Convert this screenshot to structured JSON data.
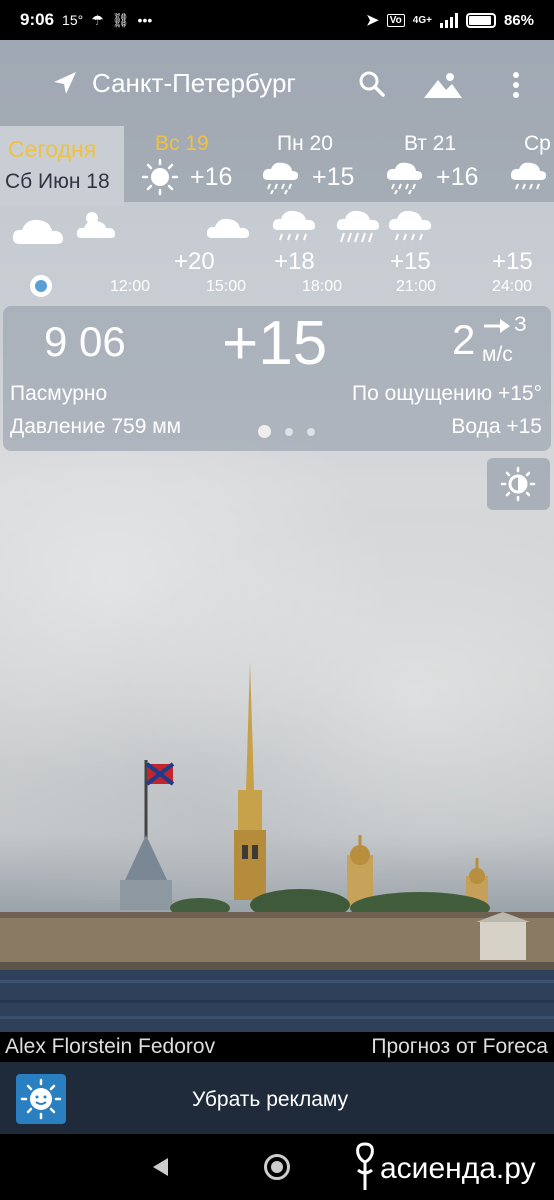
{
  "status": {
    "time": "9:06",
    "temp": "15°",
    "battery": "86%",
    "net": "4G+"
  },
  "header": {
    "city": "Санкт-Петербург"
  },
  "today": {
    "label": "Сегодня",
    "date": "Сб Июн 18"
  },
  "days": [
    {
      "label": "Вс 19",
      "temp": "+16",
      "icon": "sun-icon"
    },
    {
      "label": "Пн 20",
      "temp": "+15",
      "icon": "rain-cloud-icon"
    },
    {
      "label": "Вт 21",
      "temp": "+16",
      "icon": "rain-cloud-icon"
    },
    {
      "label": "Ср",
      "temp": "",
      "icon": "rain-cloud-icon"
    }
  ],
  "hours": [
    {
      "time": "12:00",
      "temp": "+20"
    },
    {
      "time": "15:00",
      "temp": "+18"
    },
    {
      "time": "18:00",
      "temp": "+15"
    },
    {
      "time": "21:00",
      "temp": "+15"
    },
    {
      "time": "24:00",
      "temp": ""
    }
  ],
  "current": {
    "clock": "9 06",
    "temp": "+15",
    "wind_speed": "2",
    "wind_dir": "З",
    "wind_unit": "м/с",
    "condition": "Пасмурно",
    "feels": "По ощущению +15°",
    "pressure": "Давление 759 мм",
    "water": "Вода +15"
  },
  "footer": {
    "credit": "Alex Florstein Fedorov",
    "provider": "Прогноз от Foreca",
    "ad": "Убрать рекламу",
    "watermark": "асиенда.ру"
  }
}
